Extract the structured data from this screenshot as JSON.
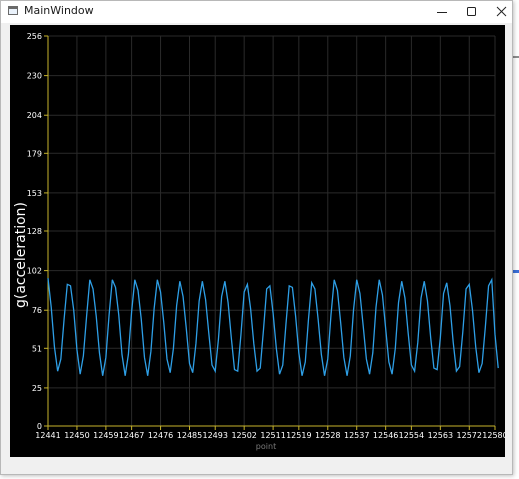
{
  "window": {
    "title": "MainWindow",
    "controls": {
      "minimize_icon": "minimize-icon",
      "maximize_icon": "maximize-icon",
      "close_icon": "close-icon"
    }
  },
  "colors": {
    "plot_background": "#000000",
    "axis_line": "#c8b42c",
    "series_line": "#2e9fe6",
    "tick_label": "#ffffff",
    "grid": "#2a2a2a"
  },
  "chart_data": {
    "type": "line",
    "title": "",
    "xlabel": "point",
    "ylabel": "g(acceleration)",
    "xlim": [
      12441,
      12580
    ],
    "ylim": [
      0,
      256
    ],
    "grid": true,
    "x_ticks": [
      "12441",
      "12450",
      "12459",
      "12467",
      "12476",
      "12485",
      "12493",
      "12502",
      "12511",
      "12519",
      "12528",
      "12537",
      "12546",
      "12554",
      "12563",
      "12572",
      "12580"
    ],
    "y_ticks": [
      "0",
      "25",
      "51",
      "76",
      "102",
      "128",
      "153",
      "179",
      "204",
      "230",
      "256"
    ],
    "series": [
      {
        "x_start": 12441,
        "x_step": 1,
        "values": [
          97,
          78,
          52,
          36,
          44,
          70,
          93,
          92,
          76,
          50,
          34,
          46,
          72,
          96,
          90,
          72,
          48,
          33,
          45,
          73,
          96,
          91,
          73,
          47,
          33,
          47,
          75,
          96,
          89,
          70,
          45,
          33,
          49,
          77,
          96,
          88,
          68,
          44,
          35,
          51,
          79,
          95,
          85,
          64,
          41,
          35,
          54,
          82,
          95,
          83,
          61,
          40,
          36,
          57,
          85,
          95,
          81,
          58,
          37,
          36,
          60,
          88,
          93,
          77,
          54,
          36,
          38,
          63,
          90,
          92,
          74,
          51,
          34,
          40,
          67,
          92,
          91,
          72,
          48,
          33,
          42,
          70,
          94,
          90,
          70,
          47,
          33,
          44,
          73,
          96,
          89,
          68,
          45,
          33,
          46,
          76,
          96,
          87,
          66,
          44,
          34,
          48,
          78,
          96,
          86,
          64,
          42,
          34,
          51,
          81,
          95,
          84,
          61,
          40,
          36,
          55,
          84,
          95,
          82,
          58,
          38,
          37,
          58,
          87,
          94,
          79,
          55,
          36,
          39,
          62,
          90,
          93,
          76,
          52,
          35,
          41,
          65,
          92,
          96,
          60,
          38
        ]
      }
    ]
  }
}
